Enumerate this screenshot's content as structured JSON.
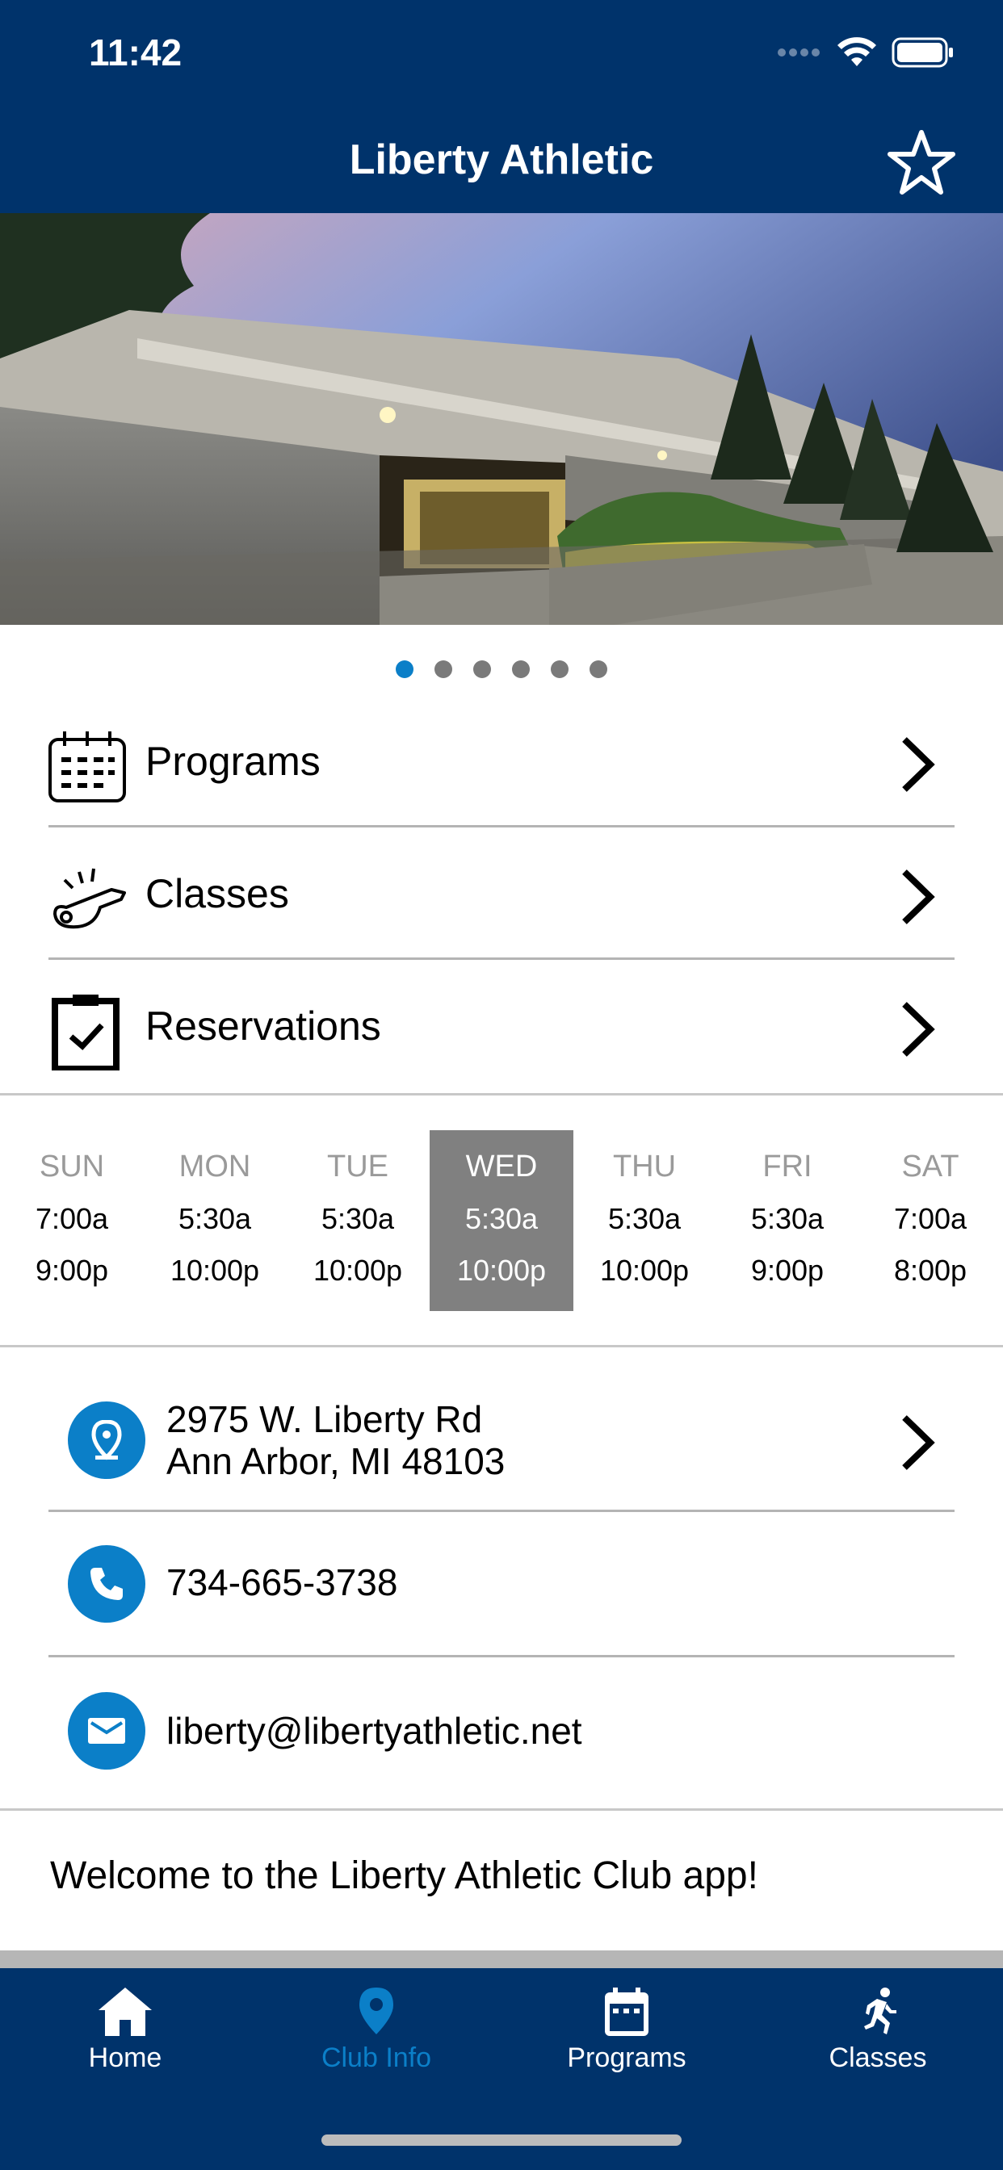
{
  "status_bar": {
    "time": "11:42"
  },
  "nav": {
    "title": "Liberty Athletic",
    "favorite_icon": "star-outline-icon"
  },
  "carousel": {
    "page_count": 6,
    "active_index": 0
  },
  "menu": [
    {
      "label": "Programs",
      "icon": "calendar-icon"
    },
    {
      "label": "Classes",
      "icon": "whistle-icon"
    },
    {
      "label": "Reservations",
      "icon": "clipboard-check-icon"
    }
  ],
  "hours": [
    {
      "day": "SUN",
      "open": "7:00a",
      "close": "9:00p"
    },
    {
      "day": "MON",
      "open": "5:30a",
      "close": "10:00p"
    },
    {
      "day": "TUE",
      "open": "5:30a",
      "close": "10:00p"
    },
    {
      "day": "WED",
      "open": "5:30a",
      "close": "10:00p",
      "selected": true
    },
    {
      "day": "THU",
      "open": "5:30a",
      "close": "10:00p"
    },
    {
      "day": "FRI",
      "open": "5:30a",
      "close": "9:00p"
    },
    {
      "day": "SAT",
      "open": "7:00a",
      "close": "8:00p"
    }
  ],
  "contact": {
    "address_line1": "2975 W. Liberty Rd",
    "address_line2": "Ann Arbor, MI 48103",
    "phone": "734-665-3738",
    "email": "liberty@libertyathletic.net"
  },
  "welcome": "Welcome to the Liberty Athletic Club app!",
  "tabs": [
    {
      "label": "Home",
      "icon": "home-icon"
    },
    {
      "label": "Club Info",
      "icon": "location-pin-icon",
      "active": true
    },
    {
      "label": "Programs",
      "icon": "calendar-icon"
    },
    {
      "label": "Classes",
      "icon": "runner-icon"
    }
  ],
  "colors": {
    "nav_bg": "#00336b",
    "accent": "#0b7fc8",
    "selected_day": "#808080"
  }
}
